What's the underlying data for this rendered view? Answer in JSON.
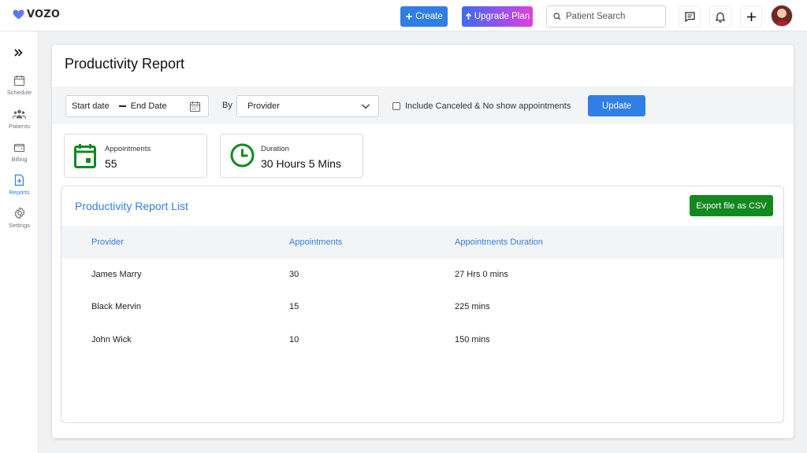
{
  "app": {
    "brand": "VOZO",
    "accent": "#2f7fe6",
    "brand_green": "#12891f"
  },
  "header": {
    "create_label": "Create",
    "upgrade_label": "Upgrade Plan",
    "search_placeholder": "Patient Search",
    "icons": [
      "chat-icon",
      "bell-icon",
      "plus-icon"
    ]
  },
  "sidebar": {
    "expand_icon": "double-chevron-right-icon",
    "items": [
      {
        "label": "Schedule",
        "icon": "calendar-icon"
      },
      {
        "label": "Patients",
        "icon": "users-icon"
      },
      {
        "label": "Billing",
        "icon": "wallet-icon"
      },
      {
        "label": "Reports",
        "icon": "report-icon",
        "active": true
      },
      {
        "label": "Settings",
        "icon": "gear-icon"
      }
    ]
  },
  "page": {
    "title": "Productivity Report",
    "filters": {
      "start_date": "Start date",
      "end_date": "End Date",
      "by_label": "By",
      "by_value": "Provider",
      "include_canceled": "Include Canceled & No show appointments",
      "update_label": "Update"
    },
    "stats": [
      {
        "label": "Appointments",
        "value": "55"
      },
      {
        "label": "Duration",
        "value": "30 Hours 5 Mins"
      }
    ],
    "list": {
      "title": "Productivity Report List",
      "export_label": "Export file as CSV",
      "columns": [
        "Provider",
        "Appointments",
        "Appointments Duration"
      ],
      "rows": [
        [
          "James Marry",
          "30",
          "27 Hrs 0 mins"
        ],
        [
          "Black Mervin",
          "15",
          "225 mins"
        ],
        [
          "John Wick",
          "10",
          "150 mins"
        ]
      ]
    }
  }
}
